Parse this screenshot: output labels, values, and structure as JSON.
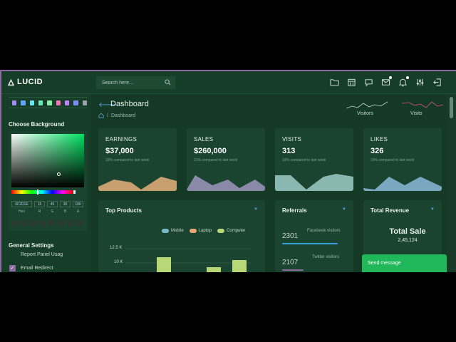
{
  "brand": {
    "name": "LUCID"
  },
  "search": {
    "placeholder": "Search here..."
  },
  "nav_icons": [
    "folder-icon",
    "calendar-icon",
    "chat-icon",
    "mail-icon",
    "bell-icon",
    "sliders-icon",
    "logout-icon"
  ],
  "sidebar": {
    "swatches": [
      "#a78bfa",
      "#60a5fa",
      "#67e8f9",
      "#6ee7b7",
      "#86efac",
      "#f472b6",
      "#c084fc",
      "#818cf8",
      "#9ca3af"
    ],
    "choose_background": "Choose Background",
    "picker": {
      "hex": "0F2D1E",
      "r": "15",
      "g": "45",
      "b": "30",
      "a": "100",
      "labels": {
        "hex": "Hex",
        "r": "R",
        "g": "G",
        "b": "B",
        "a": "A"
      }
    },
    "general_settings": "General Settings",
    "report_panel": "Report Panel Usag",
    "email_redirect": "Email Redirect"
  },
  "header": {
    "title": "Dashboard",
    "breadcrumb": "Dashboard",
    "visitors_label": "Visitors",
    "visits_label": "Visits"
  },
  "cards": [
    {
      "title": "EARNINGS",
      "value": "$37,000",
      "note": "19% compared to last week",
      "color": "#c8a070"
    },
    {
      "title": "SALES",
      "value": "$260,000",
      "note": "21% compared to last week",
      "color": "#8a8aa8"
    },
    {
      "title": "VISITS",
      "value": "313",
      "note": "19% compared to last week",
      "color": "#8ab8b0"
    },
    {
      "title": "LIKES",
      "value": "326",
      "note": "19% compared to last week",
      "color": "#7aa8c0"
    }
  ],
  "top_products": {
    "title": "Top Products",
    "legend": [
      {
        "name": "Mobile",
        "color": "#7ab8c8"
      },
      {
        "name": "Laptop",
        "color": "#e8a878"
      },
      {
        "name": "Computer",
        "color": "#b8d878"
      }
    ],
    "y_ticks": [
      "12.5 K",
      "10 K"
    ]
  },
  "referrals": {
    "title": "Referrals",
    "items": [
      {
        "count": "2301",
        "label": "Facebook visitors",
        "fill": 0.7,
        "color": "#3aa0e0"
      },
      {
        "count": "2107",
        "label": "Twitter visitors",
        "fill": 0.3,
        "color": "#8a6aa0"
      }
    ]
  },
  "total_revenue": {
    "title": "Total Revenue",
    "sale_label": "Total Sale",
    "sale_value": "2,45,124"
  },
  "send_message": {
    "label": "Send message"
  }
}
